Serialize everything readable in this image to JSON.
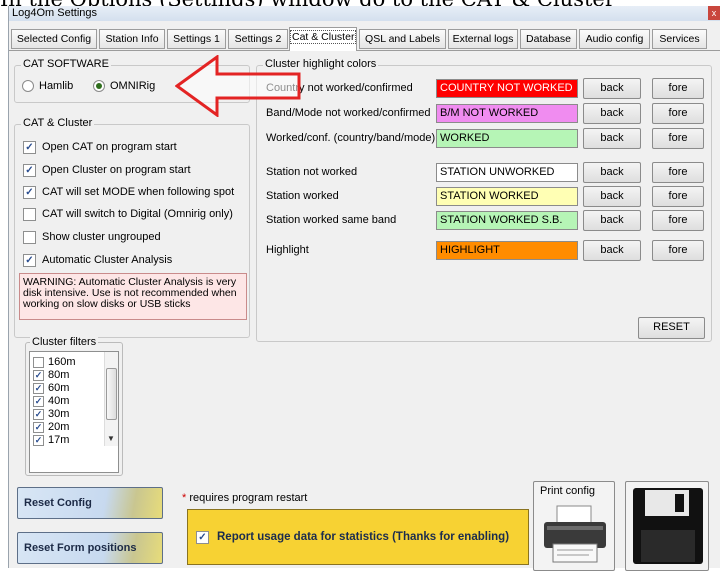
{
  "caption": "In the Options (Settings) window go to the CAT & Cluster",
  "window": {
    "title": "Log4Om Settings",
    "close_glyph": "x"
  },
  "tabs": [
    {
      "label": "Selected Config"
    },
    {
      "label": "Station Info"
    },
    {
      "label": "Settings 1"
    },
    {
      "label": "Settings 2"
    },
    {
      "label": "Cat & Cluster",
      "active": true
    },
    {
      "label": "QSL and Labels"
    },
    {
      "label": "External logs"
    },
    {
      "label": "Database"
    },
    {
      "label": "Audio config"
    },
    {
      "label": "Services"
    }
  ],
  "cat_software": {
    "title": "CAT SOFTWARE",
    "options": [
      {
        "label": "Hamlib",
        "selected": false
      },
      {
        "label": "OMNIRig",
        "selected": true
      }
    ]
  },
  "cat_cluster": {
    "title": "CAT & Cluster",
    "options": [
      {
        "label": "Open CAT on program start",
        "checked": true
      },
      {
        "label": "Open Cluster on program start",
        "checked": true
      },
      {
        "label": "CAT will set MODE when following spot",
        "checked": true
      },
      {
        "label": "CAT will switch to Digital (Omnirig only)",
        "checked": false
      },
      {
        "label": "Show cluster ungrouped",
        "checked": false
      },
      {
        "label": "Automatic Cluster Analysis",
        "checked": true
      }
    ],
    "warning": "WARNING: Automatic Cluster Analysis is very disk intensive. Use is not recommended when working on slow disks or USB sticks"
  },
  "highlight": {
    "title": "Cluster highlight colors",
    "back_label": "back",
    "fore_label": "fore",
    "rows": [
      {
        "label": "Country not worked/confirmed",
        "sample": "COUNTRY NOT WORKED",
        "bg": "#ff0000",
        "fg": "#ffffff"
      },
      {
        "label": "Band/Mode not worked/confirmed",
        "sample": "B/M NOT WORKED",
        "bg": "#f08cf0",
        "fg": "#000000"
      },
      {
        "label": "Worked/conf. (country/band/mode)",
        "sample": "WORKED",
        "bg": "#b6f5b6",
        "fg": "#000000"
      },
      {
        "label": "Station not worked",
        "sample": "STATION UNWORKED",
        "bg": "#ffffff",
        "fg": "#000000"
      },
      {
        "label": "Station worked",
        "sample": "STATION WORKED",
        "bg": "#ffffb4",
        "fg": "#000000"
      },
      {
        "label": "Station worked same band",
        "sample": "STATION WORKED S.B.",
        "bg": "#b6f5b6",
        "fg": "#000000"
      },
      {
        "label": "Highlight",
        "sample": "HIGHLIGHT",
        "bg": "#ff8c00",
        "fg": "#000000"
      }
    ],
    "reset_label": "RESET"
  },
  "cluster_filters": {
    "title": "Cluster filters",
    "items": [
      {
        "label": "160m",
        "checked": false
      },
      {
        "label": "80m",
        "checked": true
      },
      {
        "label": "60m",
        "checked": true
      },
      {
        "label": "40m",
        "checked": true
      },
      {
        "label": "30m",
        "checked": true
      },
      {
        "label": "20m",
        "checked": true
      },
      {
        "label": "17m",
        "checked": true
      }
    ]
  },
  "footer": {
    "reset_config": "Reset Config",
    "reset_form_positions": "Reset Form positions",
    "required_note": "requires program restart",
    "required_star": "*",
    "stats_label": "Report usage data for statistics (Thanks for enabling)",
    "stats_checked": true,
    "print_config": "Print config"
  },
  "colors": {
    "arrow": "#e32424",
    "warning_bg": "#fde6e6",
    "stats_bg": "#f7d233"
  }
}
